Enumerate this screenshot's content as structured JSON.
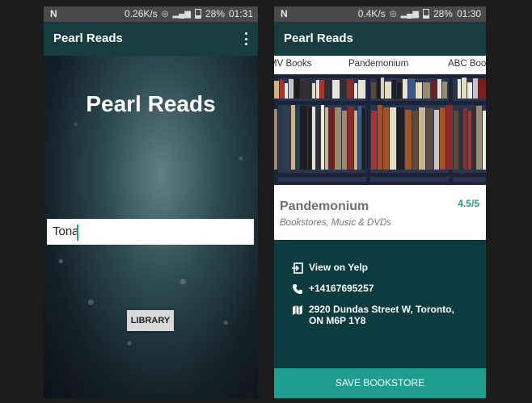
{
  "left": {
    "status": {
      "speed": "0.26K/s",
      "battery": "28%",
      "time": "01:31"
    },
    "app_title": "Pearl Reads",
    "hero_title": "Pearl Reads",
    "search_value": "Tona",
    "library_label": "LIBRARY"
  },
  "right": {
    "status": {
      "speed": "0.4K/s",
      "battery": "28%",
      "time": "01:30"
    },
    "app_title": "Pearl Reads",
    "tabs": [
      "MV Books",
      "Pandemonium",
      "ABC Boo"
    ],
    "active_tab": "Pandemonium",
    "store": {
      "name": "Pandemonium",
      "rating": "4.5/5",
      "categories": "Bookstores, Music & DVDs",
      "yelp_label": "View on Yelp",
      "phone": "+14167695257",
      "address_line1": "2920 Dundas Street W, Toronto,",
      "address_line2": "ON M6P 1Y8"
    },
    "save_label": "SAVE BOOKSTORE"
  },
  "colors": {
    "appbar": "#183d40",
    "accent": "#1f9e8f",
    "detail_bg": "#0c3b40",
    "rating": "#1e9e94"
  },
  "icons": [
    "n-logo-icon",
    "wifi-icon",
    "signal-icon",
    "battery-icon",
    "more-vert-icon",
    "open-external-icon",
    "phone-icon",
    "map-icon"
  ]
}
